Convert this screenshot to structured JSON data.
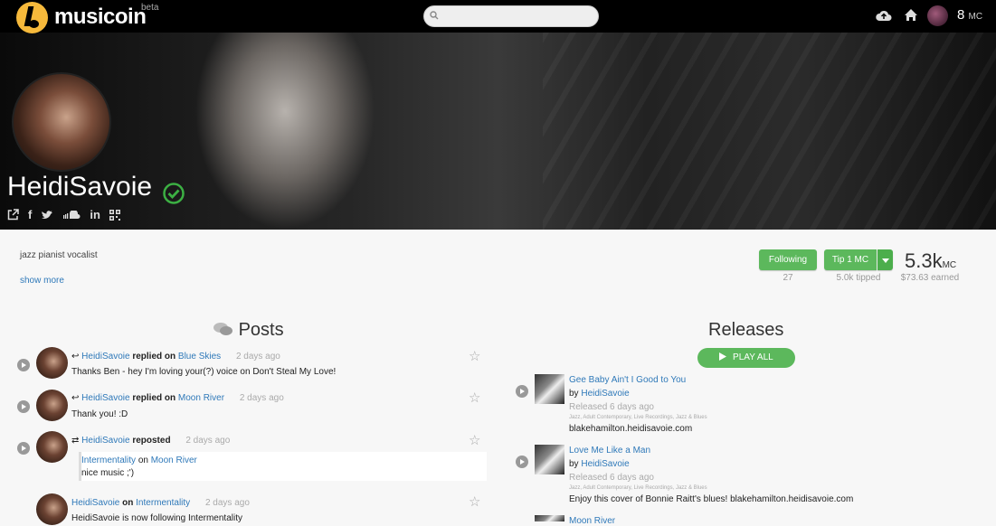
{
  "app": {
    "name": "musicoin",
    "beta": "beta"
  },
  "search": {
    "placeholder": ""
  },
  "user": {
    "balance": "8",
    "unit": "MC"
  },
  "artist": {
    "name": "HeidiSavoie",
    "bio": "jazz pianist vocalist",
    "show_more": "show more"
  },
  "actions": {
    "following_label": "Following",
    "following_count": "27",
    "tip_label": "Tip 1 MC",
    "tipped": "5.0k tipped",
    "earnings": "5.3k",
    "earnings_unit": "MC",
    "earned_usd": "$73.63 earned"
  },
  "posts": {
    "title": "Posts",
    "items": [
      {
        "user": "HeidiSavoie",
        "action": "replied on",
        "target": "Blue Skies",
        "time": "2 days ago",
        "text": "Thanks Ben - hey I'm loving your(?) voice on Don't Steal My Love!"
      },
      {
        "user": "HeidiSavoie",
        "action": "replied on",
        "target": "Moon River",
        "time": "2 days ago",
        "text": "Thank you! :D"
      },
      {
        "user": "HeidiSavoie",
        "action": "reposted",
        "target": "",
        "time": "2 days ago",
        "quote_user": "Intermentality",
        "quote_on": "on",
        "quote_target": "Moon River",
        "quote_text": "nice music ;')"
      },
      {
        "user": "HeidiSavoie",
        "action": "on",
        "target": "Intermentality",
        "time": "2 days ago",
        "text": "HeidiSavoie is now following Intermentality"
      }
    ]
  },
  "releases": {
    "title": "Releases",
    "play_all": "PLAY ALL",
    "items": [
      {
        "title": "Gee Baby Ain't I Good to You",
        "by": "by",
        "artist": "HeidiSavoie",
        "released": "Released 6 days ago",
        "tags": "Jazz, Adult Contemporary, Live Recordings, Jazz & Blues",
        "desc": "blakehamilton.heidisavoie.com"
      },
      {
        "title": "Love Me Like a Man",
        "by": "by",
        "artist": "HeidiSavoie",
        "released": "Released 6 days ago",
        "tags": "Jazz, Adult Contemporary, Live Recordings, Jazz & Blues",
        "desc": "Enjoy this cover of Bonnie Raitt's blues! blakehamilton.heidisavoie.com"
      },
      {
        "title": "Moon River"
      }
    ]
  },
  "colors": {
    "accent": "#5cb85c",
    "link": "#2f79b9",
    "logo": "#f6b93b",
    "verified": "#3cb043"
  }
}
